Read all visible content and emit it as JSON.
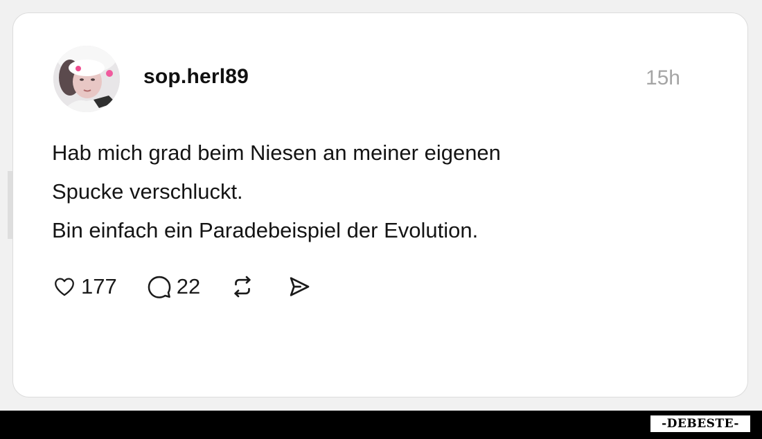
{
  "watermark": {
    "side_text": "DEBESTE",
    "brand_badge": "-DEBESTE-"
  },
  "post": {
    "author": {
      "username": "sop.herl89"
    },
    "time_ago": "15h",
    "text_lines": [
      "Hab mich grad beim Niesen an meiner eigenen",
      "Spucke verschluckt.",
      "Bin einfach ein Paradebeispiel der Evolution."
    ],
    "actions": {
      "likes": "177",
      "replies": "22",
      "icons": [
        "heart-icon",
        "comment-icon",
        "repost-icon",
        "share-icon"
      ]
    }
  },
  "colors": {
    "background": "#f1f1f1",
    "card": "#ffffff",
    "text": "#111111",
    "muted": "#a5a5a5",
    "footer": "#000000"
  }
}
